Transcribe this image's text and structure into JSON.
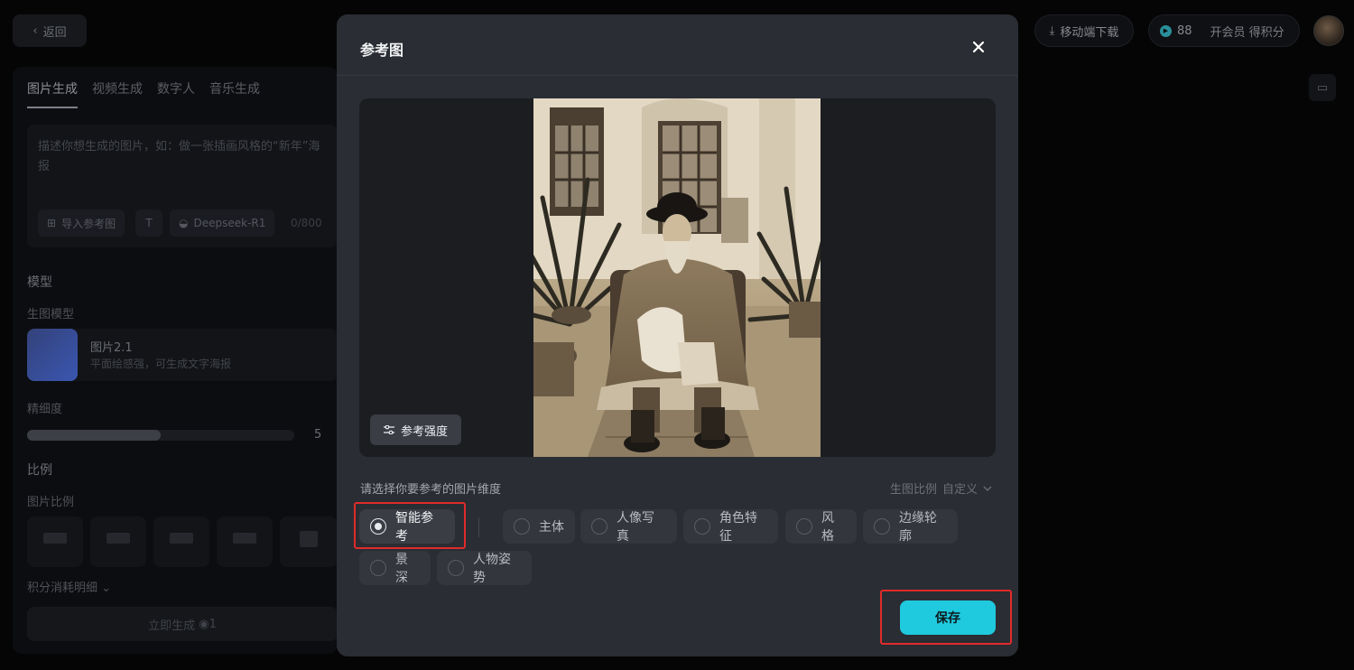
{
  "app": {
    "back_label": "返回",
    "mobile_download": "移动端下载",
    "points": "88",
    "vip_label": "开会员 得积分",
    "tabs": [
      "图片生成",
      "视频生成",
      "数字人",
      "音乐生成"
    ],
    "prompt_placeholder": "描述你想生成的图片，如：做一张插画风格的“新年”海报",
    "import_ref": "导入参考图",
    "deepseek": "Deepseek-R1",
    "char_count": "0/800",
    "model_section": "模型",
    "model_sub": "生图模型",
    "model_name": "图片2.1",
    "model_desc": "平面绘感强，可生成文字海报",
    "detail_label": "精细度",
    "detail_value": "5",
    "detail_level": 0.5,
    "ratio_section": "比例",
    "ratio_sub": "图片比例",
    "cost_detail": "积分消耗明细",
    "generate_label": "立即生成",
    "generate_cost": "1"
  },
  "modal": {
    "title": "参考图",
    "strength_label": "参考强度",
    "dimension_prompt": "请选择你要参考的图片维度",
    "ratio_label": "生图比例",
    "ratio_value": "自定义",
    "options": [
      {
        "label": "智能参考",
        "selected": true
      },
      {
        "label": "主体",
        "selected": false
      },
      {
        "label": "人像写真",
        "selected": false
      },
      {
        "label": "角色特征",
        "selected": false
      },
      {
        "label": "风格",
        "selected": false
      },
      {
        "label": "边缘轮廓",
        "selected": false
      },
      {
        "label": "景深",
        "selected": false
      },
      {
        "label": "人物姿势",
        "selected": false
      }
    ],
    "save_label": "保存"
  },
  "colors": {
    "accent": "#1fc9de",
    "highlight": "#e02b2b",
    "modal_bg": "#2a2d33"
  },
  "icons": [
    "chevron-left-icon",
    "download-icon",
    "coin-icon",
    "close-icon",
    "sliders-icon",
    "chevron-down-icon",
    "folder-icon"
  ]
}
